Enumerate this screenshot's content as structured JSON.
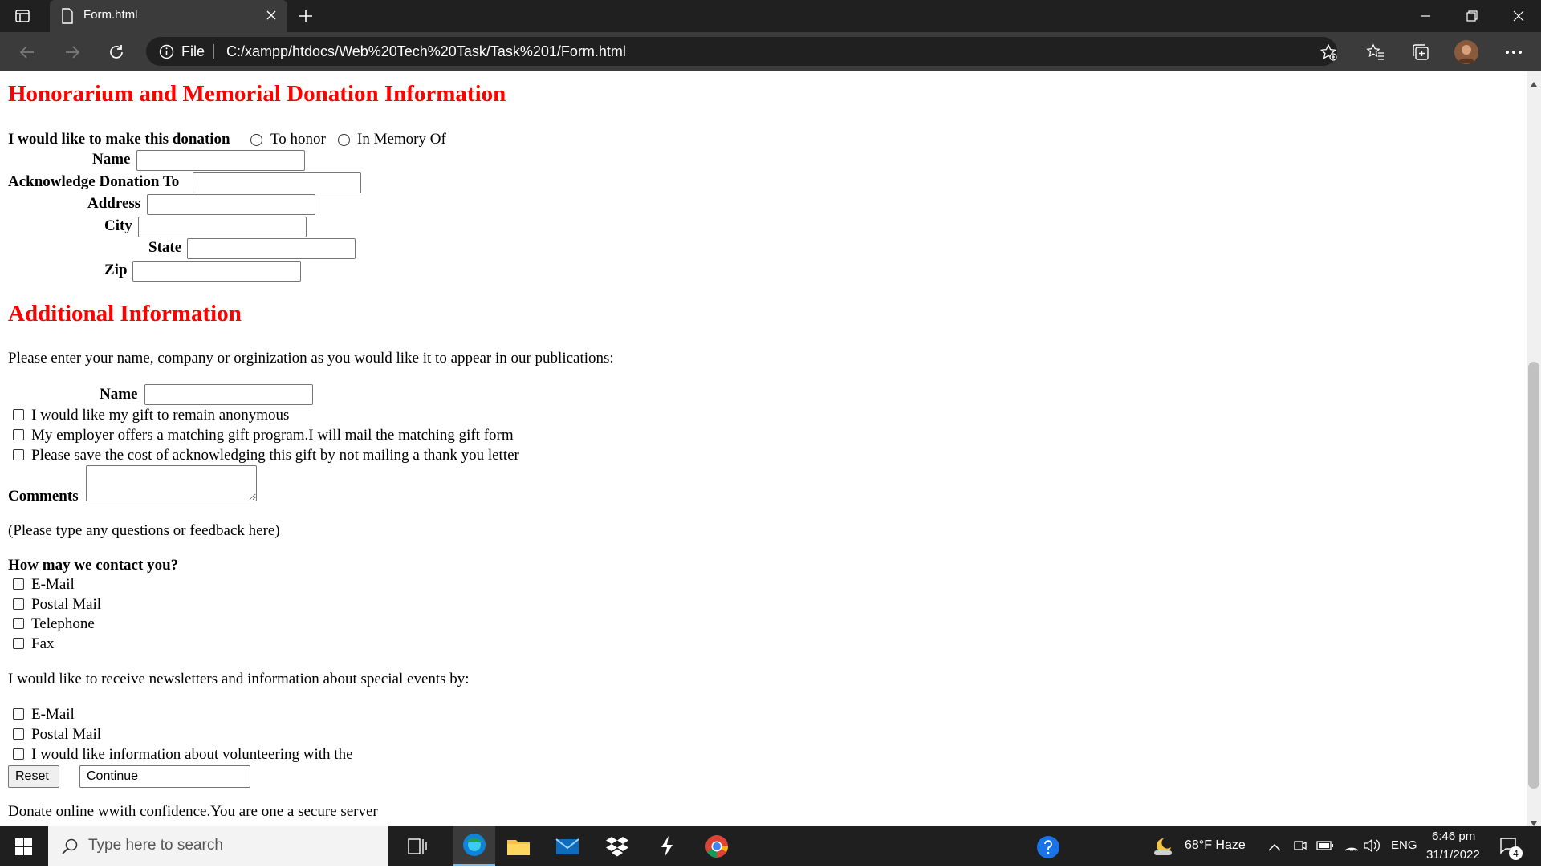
{
  "browser": {
    "tab_title": "Form.html",
    "file_label": "File",
    "url": "C:/xampp/htdocs/Web%20Tech%20Task/Task%201/Form.html"
  },
  "form": {
    "honorarium_heading": "Honorarium and Memorial Donation Information",
    "donation_prompt": "I would like to make this donation",
    "radio_honor": "To honor",
    "radio_memory": "In Memory Of",
    "name_label": "Name",
    "acknowledge_label": "Acknowledge Donation To",
    "address_label": "Address",
    "city_label": "City",
    "state_label": "State",
    "zip_label": "Zip",
    "additional_heading": "Additional Information",
    "publication_prompt": "Please enter your name, company or orginization as you would like it to appear in our publications:",
    "pub_name_label": "Name",
    "cb_anonymous": "I would like my gift to remain anonymous",
    "cb_matching": "My employer offers a matching gift program.I will mail the matching gift form",
    "cb_save_cost": "Please save the cost of acknowledging this gift by not mailing a thank you letter",
    "comments_label": "Comments",
    "comments_hint": "(Please type any questions or feedback here)",
    "contact_heading": "How may we contact you?",
    "contact_email": "E-Mail",
    "contact_postal": "Postal Mail",
    "contact_phone": "Telephone",
    "contact_fax": "Fax",
    "newsletter_prompt": "I would like to receive newsletters and information about special events by:",
    "news_email": "E-Mail",
    "news_postal": "Postal Mail",
    "news_volunteer": "I would like information about volunteering with the",
    "reset_label": "Reset",
    "continue_label": "Continue",
    "secure_note": "Donate online wwith confidence.You are one a secure server"
  },
  "taskbar": {
    "search_placeholder": "Type here to search",
    "weather": "68°F  Haze",
    "language": "ENG",
    "time": "6:46 pm",
    "date": "31/1/2022",
    "notification_count": "4"
  }
}
